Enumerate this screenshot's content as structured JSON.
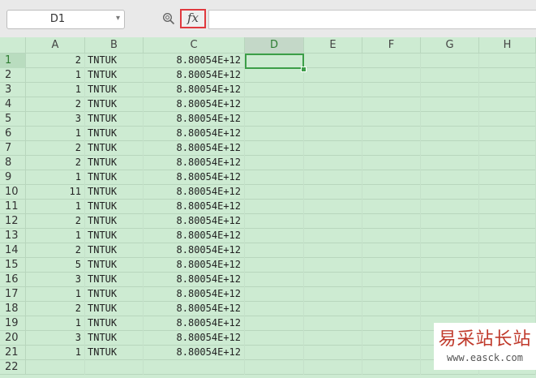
{
  "toolbar": {
    "name_box": "D1",
    "fx_label": "fx",
    "formula_value": ""
  },
  "columns": [
    "A",
    "B",
    "C",
    "D",
    "E",
    "F",
    "G",
    "H"
  ],
  "active_column": "D",
  "active_row": "1",
  "rows": [
    {
      "n": "1",
      "a": "2",
      "b": "TNTUK",
      "c": "8.80054E+12"
    },
    {
      "n": "2",
      "a": "1",
      "b": "TNTUK",
      "c": "8.80054E+12"
    },
    {
      "n": "3",
      "a": "1",
      "b": "TNTUK",
      "c": "8.80054E+12"
    },
    {
      "n": "4",
      "a": "2",
      "b": "TNTUK",
      "c": "8.80054E+12"
    },
    {
      "n": "5",
      "a": "3",
      "b": "TNTUK",
      "c": "8.80054E+12"
    },
    {
      "n": "6",
      "a": "1",
      "b": "TNTUK",
      "c": "8.80054E+12"
    },
    {
      "n": "7",
      "a": "2",
      "b": "TNTUK",
      "c": "8.80054E+12"
    },
    {
      "n": "8",
      "a": "2",
      "b": "TNTUK",
      "c": "8.80054E+12"
    },
    {
      "n": "9",
      "a": "1",
      "b": "TNTUK",
      "c": "8.80054E+12"
    },
    {
      "n": "10",
      "a": "11",
      "b": "TNTUK",
      "c": "8.80054E+12"
    },
    {
      "n": "11",
      "a": "1",
      "b": "TNTUK",
      "c": "8.80054E+12"
    },
    {
      "n": "12",
      "a": "2",
      "b": "TNTUK",
      "c": "8.80054E+12"
    },
    {
      "n": "13",
      "a": "1",
      "b": "TNTUK",
      "c": "8.80054E+12"
    },
    {
      "n": "14",
      "a": "2",
      "b": "TNTUK",
      "c": "8.80054E+12"
    },
    {
      "n": "15",
      "a": "5",
      "b": "TNTUK",
      "c": "8.80054E+12"
    },
    {
      "n": "16",
      "a": "3",
      "b": "TNTUK",
      "c": "8.80054E+12"
    },
    {
      "n": "17",
      "a": "1",
      "b": "TNTUK",
      "c": "8.80054E+12"
    },
    {
      "n": "18",
      "a": "2",
      "b": "TNTUK",
      "c": "8.80054E+12"
    },
    {
      "n": "19",
      "a": "1",
      "b": "TNTUK",
      "c": "8.80054E+12"
    },
    {
      "n": "20",
      "a": "3",
      "b": "TNTUK",
      "c": "8.80054E+12"
    },
    {
      "n": "21",
      "a": "1",
      "b": "TNTUK",
      "c": "8.80054E+12"
    },
    {
      "n": "22",
      "a": "",
      "b": "",
      "c": ""
    }
  ],
  "watermark": {
    "title": "易采站长站",
    "url": "www.easck.com"
  },
  "colors": {
    "sheet_bg": "#cdebd2",
    "selection": "#3c9e48",
    "fx_highlight": "#e0393e"
  }
}
